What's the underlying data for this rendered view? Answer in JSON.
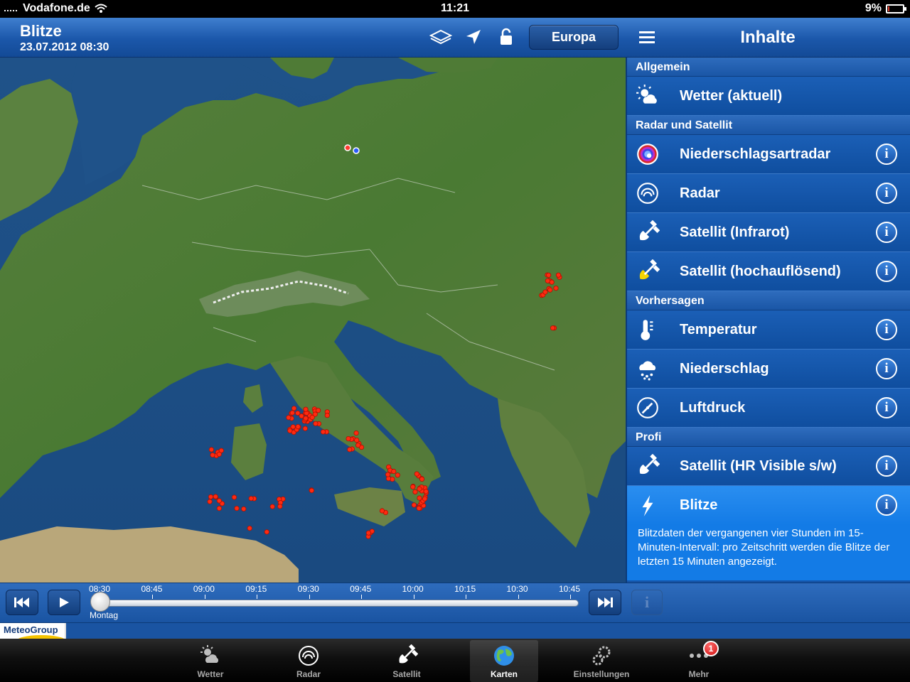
{
  "status_bar": {
    "carrier": "Vodafone.de",
    "time": "11:21",
    "battery": "9%",
    "battery_level": 0.09
  },
  "header": {
    "title": "Blitze",
    "datetime": "23.07.2012 08:30",
    "region_button": "Europa",
    "panel_title": "Inhalte"
  },
  "sections": [
    {
      "title": "Allgemein",
      "items": [
        {
          "label": "Wetter (aktuell)",
          "icon": "sun-cloud-icon",
          "info": false
        }
      ]
    },
    {
      "title": "Radar und Satellit",
      "items": [
        {
          "label": "Niederschlagsartradar",
          "icon": "rainbow-radar-icon",
          "info": true
        },
        {
          "label": "Radar",
          "icon": "radar-icon",
          "info": true
        },
        {
          "label": "Satellit (Infrarot)",
          "icon": "satellite-icon",
          "info": true
        },
        {
          "label": "Satellit (hochauflösend)",
          "icon": "satellite-hd-icon",
          "info": true
        }
      ]
    },
    {
      "title": "Vorhersagen",
      "items": [
        {
          "label": "Temperatur",
          "icon": "thermometer-icon",
          "info": true
        },
        {
          "label": "Niederschlag",
          "icon": "rain-cloud-icon",
          "info": true
        },
        {
          "label": "Luftdruck",
          "icon": "barometer-icon",
          "info": true
        }
      ]
    },
    {
      "title": "Profi",
      "items": [
        {
          "label": "Satellit (HR Visible s/w)",
          "icon": "satellite-bw-icon",
          "info": true
        },
        {
          "label": "Blitze",
          "icon": "lightning-icon",
          "info": true,
          "active": true,
          "description": "Blitzdaten der vergangenen vier Stunden im 15-Minuten-Intervall: pro Zeitschritt werden die Blitze der letzten 15 Minuten angezeigt."
        }
      ]
    }
  ],
  "timeline": {
    "ticks": [
      "08:30",
      "08:45",
      "09:00",
      "09:15",
      "09:30",
      "09:45",
      "10:00",
      "10:15",
      "10:30",
      "10:45"
    ],
    "day_label": "Montag",
    "position": 0
  },
  "branding": {
    "logo_text": "MeteoGroup"
  },
  "tabbar": {
    "tabs": [
      {
        "label": "Wetter",
        "icon": "weather-icon"
      },
      {
        "label": "Radar",
        "icon": "radar-icon"
      },
      {
        "label": "Satellit",
        "icon": "satellite-icon"
      },
      {
        "label": "Karten",
        "icon": "globe-icon",
        "selected": true
      },
      {
        "label": "Einstellungen",
        "icon": "gears-icon"
      },
      {
        "label": "Mehr",
        "icon": "more-icon",
        "badge": "1"
      }
    ]
  },
  "colors": {
    "accent": "#1555a8",
    "active_row": "#137be6",
    "lightning_marks": "#ff2a10",
    "sea": "#1d4c85",
    "land": "#4b7a34"
  }
}
